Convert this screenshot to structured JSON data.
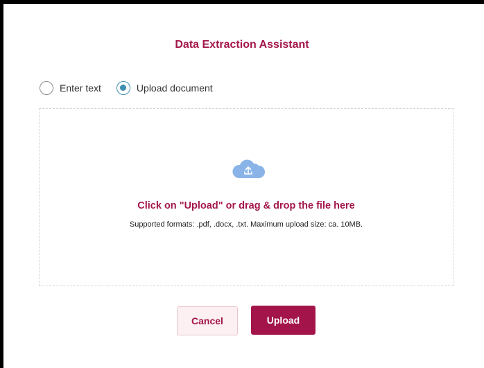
{
  "dialog": {
    "title": "Data Extraction Assistant"
  },
  "input_mode": {
    "options": [
      {
        "label": "Enter text",
        "selected": false
      },
      {
        "label": "Upload document",
        "selected": true
      }
    ]
  },
  "dropzone": {
    "icon": "cloud-upload-icon",
    "title": "Click on \"Upload\" or drag & drop the file here",
    "subtitle": "Supported formats: .pdf, .docx, .txt. Maximum upload size: ca. 10MB."
  },
  "actions": {
    "cancel_label": "Cancel",
    "upload_label": "Upload"
  },
  "colors": {
    "accent": "#a3154a",
    "radio_selected": "#3e8fb0",
    "cloud": "#8ab4e8",
    "cancel_bg": "#fdf0f2"
  }
}
